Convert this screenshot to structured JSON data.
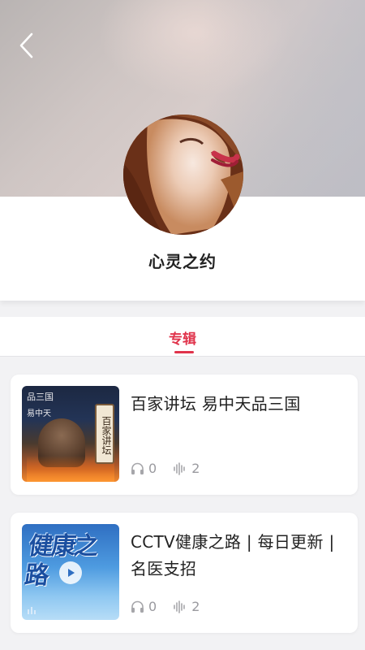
{
  "header": {
    "back_icon": "chevron-left-icon"
  },
  "profile": {
    "name": "心灵之约"
  },
  "tabs": [
    {
      "label": "专辑",
      "active": true
    }
  ],
  "albums": [
    {
      "title": "百家讲坛 易中天品三国",
      "cover_text": {
        "top": "品三国",
        "sub": "易中天",
        "badge": "百家讲坛"
      },
      "listens": "0",
      "tracks": "2"
    },
    {
      "title": "CCTV健康之路 | 每日更新 | 名医支招",
      "cover_text": {
        "main": "健康之路"
      },
      "listens": "0",
      "tracks": "2"
    }
  ],
  "colors": {
    "accent": "#e0334b",
    "text": "#222222",
    "muted": "#9a9a9f"
  }
}
